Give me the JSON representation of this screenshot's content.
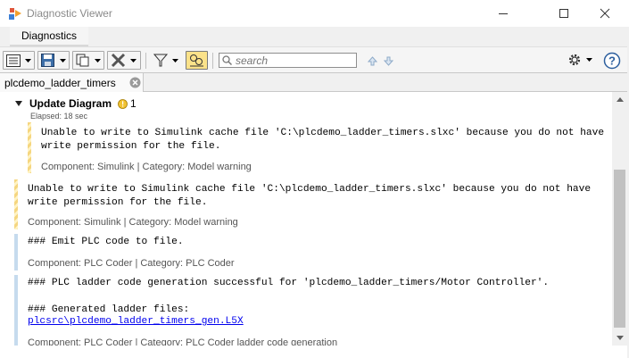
{
  "window": {
    "title": "Diagnostic Viewer",
    "icon": "simulink-app-icon",
    "controls": [
      "minimize-icon",
      "maximize-icon",
      "close-icon"
    ]
  },
  "ribbon": {
    "tab_label": "Diagnostics"
  },
  "toolbar": {
    "search_placeholder": "search",
    "buttons": [
      "expand-all-icon",
      "save-icon",
      "copy-icon",
      "clear-icon",
      "filter-icon",
      "group-by-icon"
    ],
    "nav": [
      "previous-icon",
      "next-icon"
    ],
    "settings": "gear-icon",
    "help": "help-icon"
  },
  "document_tab": {
    "label": "plcdemo_ladder_timers"
  },
  "group": {
    "title": "Update Diagram",
    "warning_count": "1",
    "elapsed": "Elapsed: 18 sec"
  },
  "messages": [
    {
      "kind": "warning",
      "line1": "Unable to write to Simulink cache file 'C:\\plcdemo_ladder_timers.slxc' because you do not have",
      "line2": "write permission for the file.",
      "meta": "Component:  Simulink | Category:  Model warning"
    },
    {
      "kind": "warning",
      "line1": "Unable to write to Simulink cache file 'C:\\plcdemo_ladder_timers.slxc' because you do not have",
      "line2": "write permission for the file.",
      "meta": "Component:  Simulink | Category:  Model warning"
    },
    {
      "kind": "info",
      "line1": "### Emit PLC code to file.",
      "meta": "Component:  PLC Coder | Category:  PLC Coder"
    },
    {
      "kind": "info",
      "line1": "### PLC ladder code generation successful for 'plcdemo_ladder_timers/Motor Controller'.",
      "line2": "### Generated ladder files:",
      "link": "plcsrc\\plcdemo_ladder_timers_gen.L5X",
      "meta": "Component:  PLC Coder | Category:  PLC Coder ladder code generation"
    }
  ],
  "colors": {
    "warning_bar": "#f5d680",
    "info_bar": "#c6dbee",
    "link": "#0000ee",
    "highlight_button": "#fbe28a"
  }
}
